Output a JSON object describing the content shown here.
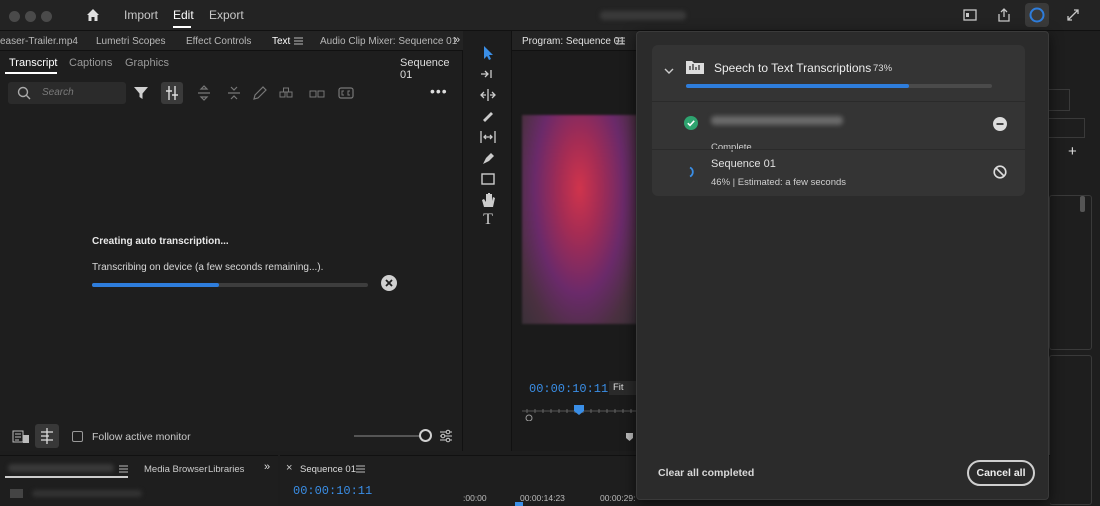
{
  "menu": {
    "import": "Import",
    "edit": "Edit",
    "export": "Export"
  },
  "left_panel": {
    "tabs": [
      "easer-Trailer.mp4",
      "Lumetri Scopes",
      "Effect Controls",
      "Text",
      "Audio Clip Mixer: Sequence 01"
    ],
    "subtabs": [
      "Transcript",
      "Captions",
      "Graphics"
    ],
    "sequence_label": "Sequence 01",
    "search_placeholder": "Search",
    "status_title": "Creating auto transcription...",
    "status_text": "Transcribing on device (a few seconds remaining...).",
    "progress": 0.46,
    "follow_label": "Follow active monitor"
  },
  "program": {
    "title": "Program: Sequence 01",
    "timecode": "00:00:10:11",
    "fit": "Fit"
  },
  "bottom": {
    "media_browser": "Media Browser",
    "libraries": "Libraries",
    "sequence_tab": "Sequence 01",
    "timecode": "00:00:10:11",
    "ruler": [
      ":00:00",
      "00:00:14:23",
      "00:00:29:"
    ]
  },
  "popup": {
    "title": "Speech to Text Transcriptions",
    "percent": "73%",
    "progress": 0.73,
    "items": [
      {
        "status": "Complete"
      },
      {
        "name": "Sequence 01",
        "status": "46% | Estimated: a few seconds"
      }
    ],
    "clear_label": "Clear all completed",
    "cancel_label": "Cancel all"
  },
  "colors": {
    "accent": "#2e7ddc",
    "complete": "#2ea36f",
    "timecode": "#3a8ee6"
  }
}
